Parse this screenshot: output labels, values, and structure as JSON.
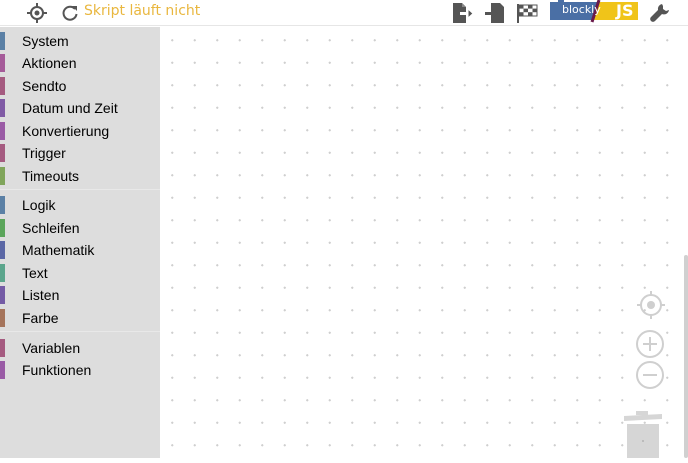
{
  "toolbar": {
    "status_text": "Skript läuft nicht",
    "blockly_label": "blockly",
    "js_label": "JS"
  },
  "categories_group1": [
    {
      "label": "System",
      "color": "#5b80a5"
    },
    {
      "label": "Aktionen",
      "color": "#a55b99"
    },
    {
      "label": "Sendto",
      "color": "#a55b80"
    },
    {
      "label": "Datum und Zeit",
      "color": "#805ba5"
    },
    {
      "label": "Konvertierung",
      "color": "#9a5ba5"
    },
    {
      "label": "Trigger",
      "color": "#a55b80"
    },
    {
      "label": "Timeouts",
      "color": "#80a55b"
    }
  ],
  "categories_group2": [
    {
      "label": "Logik",
      "color": "#5b80a5"
    },
    {
      "label": "Schleifen",
      "color": "#5ba55b"
    },
    {
      "label": "Mathematik",
      "color": "#5b67a5"
    },
    {
      "label": "Text",
      "color": "#5ba58c"
    },
    {
      "label": "Listen",
      "color": "#745ba5"
    },
    {
      "label": "Farbe",
      "color": "#a5745b"
    }
  ],
  "categories_group3": [
    {
      "label": "Variablen",
      "color": "#a55b80"
    },
    {
      "label": "Funktionen",
      "color": "#995ba5"
    }
  ],
  "colors": {
    "status": "#e9b73f",
    "icon": "#555555",
    "blockly_blue": "#4a6fa5",
    "js_yellow": "#f0c419"
  }
}
